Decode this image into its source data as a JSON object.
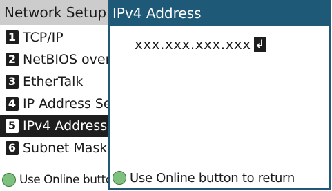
{
  "menu": {
    "title": "Network Setup",
    "items": [
      {
        "num": "1",
        "label": "TCP/IP"
      },
      {
        "num": "2",
        "label": "NetBIOS over TCP"
      },
      {
        "num": "3",
        "label": "EtherTalk"
      },
      {
        "num": "4",
        "label": "IP Address Set"
      },
      {
        "num": "5",
        "label": "IPv4 Address"
      },
      {
        "num": "6",
        "label": "Subnet Mask"
      }
    ],
    "footer_text": "Use Online button to return"
  },
  "dialog": {
    "title": "IPv4 Address",
    "ip_value": "xxx.xxx.xxx.xxx",
    "enter_glyph": "↲",
    "footer_text": "Use Online button to return"
  },
  "colors": {
    "dialog_accent": "#1e5a78",
    "menu_title_bg": "#cccccc",
    "selected_bg": "#1e1e1e",
    "online_button": "#7ec07e"
  },
  "icons": {
    "online_button": "online-button-icon",
    "enter": "enter-icon"
  }
}
